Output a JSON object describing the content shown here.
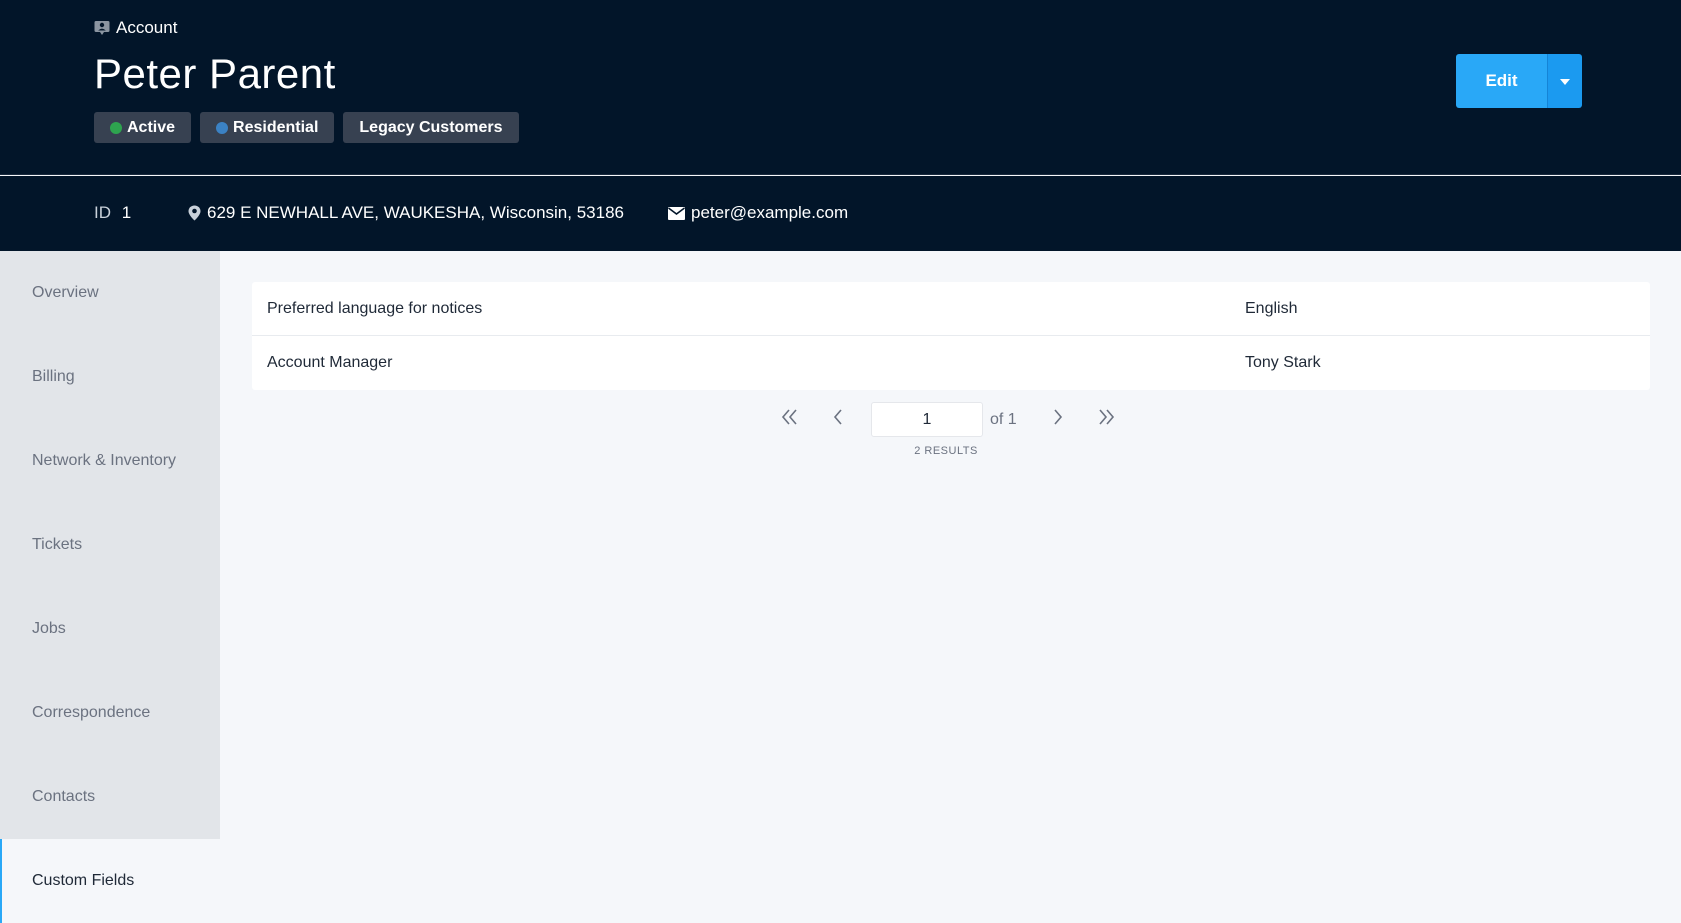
{
  "header": {
    "breadcrumb": "Account",
    "title": "Peter Parent",
    "badges": [
      {
        "label": "Active",
        "dot_color": "#2ea44f"
      },
      {
        "label": "Residential",
        "dot_color": "#3b82c4"
      },
      {
        "label": "Legacy Customers"
      }
    ],
    "edit_label": "Edit"
  },
  "info": {
    "id_label": "ID",
    "id_value": "1",
    "address": "629 E NEWHALL AVE, WAUKESHA, Wisconsin, 53186",
    "email": "peter@example.com"
  },
  "sidebar": {
    "items": [
      {
        "label": "Overview"
      },
      {
        "label": "Billing"
      },
      {
        "label": "Network & Inventory"
      },
      {
        "label": "Tickets"
      },
      {
        "label": "Jobs"
      },
      {
        "label": "Correspondence"
      },
      {
        "label": "Contacts"
      },
      {
        "label": "Custom Fields",
        "active": true
      }
    ]
  },
  "custom_fields": {
    "rows": [
      {
        "key": "Preferred language for notices",
        "value": "English"
      },
      {
        "key": "Account Manager",
        "value": "Tony Stark"
      }
    ]
  },
  "pagination": {
    "page": "1",
    "of_label": "of 1",
    "results_label": "2 RESULTS"
  },
  "colors": {
    "header_bg": "#021529",
    "accent": "#29a8f7",
    "badge_bg": "#374151"
  }
}
